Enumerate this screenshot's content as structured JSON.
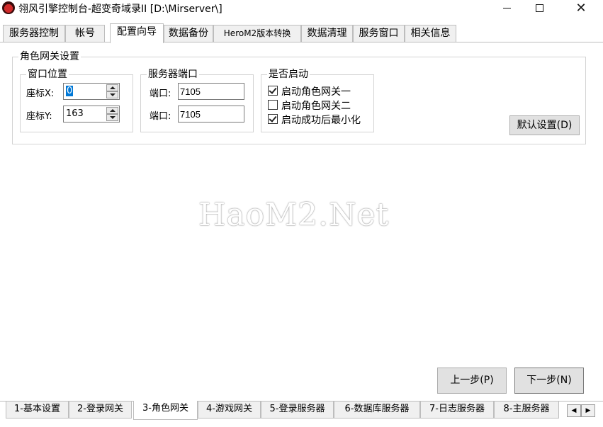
{
  "window": {
    "title": "翎风引擎控制台-超变奇域录II [D:\\Mirserver\\]",
    "icon": "app-logo-icon"
  },
  "top_tabs": [
    {
      "label": "服务器控制"
    },
    {
      "label": "帐号"
    },
    {
      "label": "配置向导",
      "active": true
    },
    {
      "label": "数据备份"
    },
    {
      "label": "HeroM2版本转换"
    },
    {
      "label": "数据清理"
    },
    {
      "label": "服务窗口"
    },
    {
      "label": "相关信息"
    }
  ],
  "role_gateway": {
    "title": "角色网关设置",
    "window_position": {
      "title": "窗口位置",
      "x_label": "座标X:",
      "x_value": "0",
      "y_label": "座标Y:",
      "y_value": "163"
    },
    "server_port": {
      "title": "服务器端口",
      "port1_label": "端口:",
      "port1_value": "7105",
      "port2_label": "端口:",
      "port2_value": "7105"
    },
    "startup": {
      "title": "是否启动",
      "options": [
        {
          "label": "启动角色网关一",
          "checked": true
        },
        {
          "label": "启动角色网关二",
          "checked": false
        },
        {
          "label": "启动成功后最小化",
          "checked": true
        }
      ]
    },
    "default_button": "默认设置(D)"
  },
  "watermark": "HaoM2.Net",
  "nav": {
    "prev": "上一步(P)",
    "next": "下一步(N)"
  },
  "bottom_tabs": [
    {
      "label": "1-基本设置"
    },
    {
      "label": "2-登录网关"
    },
    {
      "label": "3-角色网关",
      "active": true
    },
    {
      "label": "4-游戏网关"
    },
    {
      "label": "5-登录服务器"
    },
    {
      "label": "6-数据库服务器"
    },
    {
      "label": "7-日志服务器"
    },
    {
      "label": "8-主服务器"
    }
  ],
  "colors": {
    "selection": "#0078d7",
    "tab_inactive": "#f0f0f0",
    "button_face": "#e1e1e1"
  }
}
